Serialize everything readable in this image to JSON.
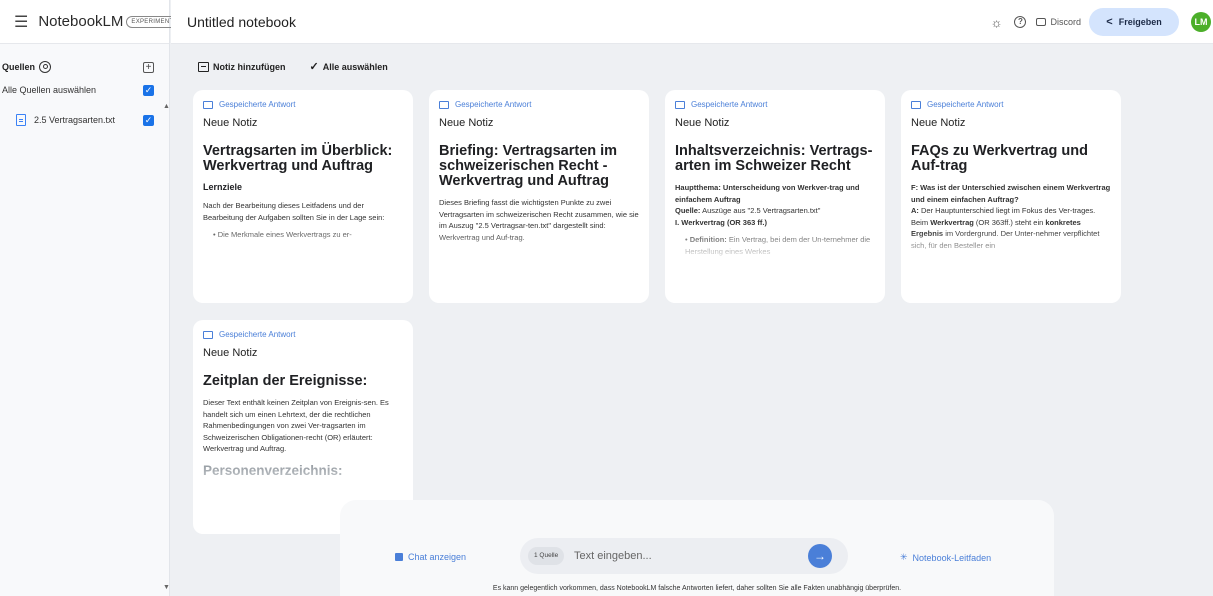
{
  "app": {
    "name": "NotebookLM",
    "badge": "EXPERIMENTAL",
    "notebook_title": "Untitled notebook"
  },
  "header": {
    "discord_label": "Discord",
    "share_label": "Freigeben",
    "avatar_initials": "LM"
  },
  "sidebar": {
    "sources_label": "Quellen",
    "select_all_label": "Alle Quellen auswählen",
    "sources": [
      {
        "name": "2.5 Vertragsarten.txt",
        "checked": true
      }
    ]
  },
  "toolbar": {
    "add_note": "Notiz hinzufügen",
    "select_all": "Alle auswählen"
  },
  "notes": [
    {
      "label": "Gespeicherte Antwort",
      "title": "Neue Notiz",
      "heading": "Vertragsarten im Überblick: Werkvertrag und Auftrag",
      "subheading": "Lernziele",
      "text": "Nach der Bearbeitung dieses Leitfadens und der Bearbeitung der Aufgaben sollten Sie in der Lage sein:",
      "bullet": "• Die Merkmale eines Werkvertrags zu er-"
    },
    {
      "label": "Gespeicherte Antwort",
      "title": "Neue Notiz",
      "heading": "Briefing: Vertragsarten im schweizerischen Recht - Werkvertrag und Auftrag",
      "text": "Dieses Briefing fasst die wichtigsten Punkte zu zwei Vertragsarten im schweizerischen Recht zusammen, wie sie im Auszug \"2.5 Vertragsar-ten.txt\" dargestellt sind: Werkvertrag und Auf-trag."
    },
    {
      "label": "Gespeicherte Antwort",
      "title": "Neue Notiz",
      "heading": "Inhaltsverzeichnis: Vertrags-arten im Schweizer Recht",
      "main_topic": "Hauptthema: Unterscheidung von Werkver-trag und einfachem Auftrag",
      "source_label": "Quelle:",
      "source_text": "Auszüge aus \"2.5 Vertragsarten.txt\"",
      "section": "I. Werkvertrag (OR 363 ff.)",
      "bullet_label": "Definition:",
      "bullet_text": "Ein Vertrag, bei dem der Un-ternehmer die Herstellung eines Werkes"
    },
    {
      "label": "Gespeicherte Antwort",
      "title": "Neue Notiz",
      "heading": "FAQs zu Werkvertrag und Auf-trag",
      "question": "F: Was ist der Unterschied zwischen einem Werkvertrag und einem einfachen Auftrag?",
      "answer_label": "A:",
      "answer_1": "Der Hauptunterschied liegt im Fokus des Ver-trages. Beim",
      "answer_bold_1": "Werkvertrag",
      "answer_2": "(OR 363ff.) steht ein",
      "answer_bold_2": "konkretes Ergebnis",
      "answer_3": "im Vordergrund. Der Unter-nehmer verpflichtet sich, für den Besteller ein"
    },
    {
      "label": "Gespeicherte Antwort",
      "title": "Neue Notiz",
      "heading": "Zeitplan der Ereignisse:",
      "text": "Dieser Text enthält keinen Zeitplan von Ereignis-sen. Es handelt sich um einen Lehrtext, der die rechtlichen Rahmenbedingungen von zwei Ver-tragsarten im Schweizerischen Obligationen-recht (OR) erläutert: Werkvertrag und Auftrag.",
      "heading2": "Personenverzeichnis:"
    }
  ],
  "chat": {
    "show_chat": "Chat anzeigen",
    "source_count": "1 Quelle",
    "placeholder": "Text eingeben...",
    "guide": "Notebook-Leitfaden",
    "disclaimer": "Es kann gelegentlich vorkommen, dass NotebookLM falsche Antworten liefert, daher sollten Sie alle Fakten unabhängig überprüfen."
  },
  "colors": {
    "accent": "#4a7fd8",
    "share_bg": "#d4e4fd",
    "avatar": "#4caf2a",
    "canvas": "#eef0f3"
  },
  "icons": [
    "menu-icon",
    "theme-icon",
    "help-icon",
    "discord-icon",
    "share-icon",
    "sources-icon",
    "add-source-icon",
    "document-icon",
    "note-add-icon",
    "check-icon",
    "saved-answer-icon",
    "chat-icon",
    "send-icon",
    "guide-icon"
  ]
}
